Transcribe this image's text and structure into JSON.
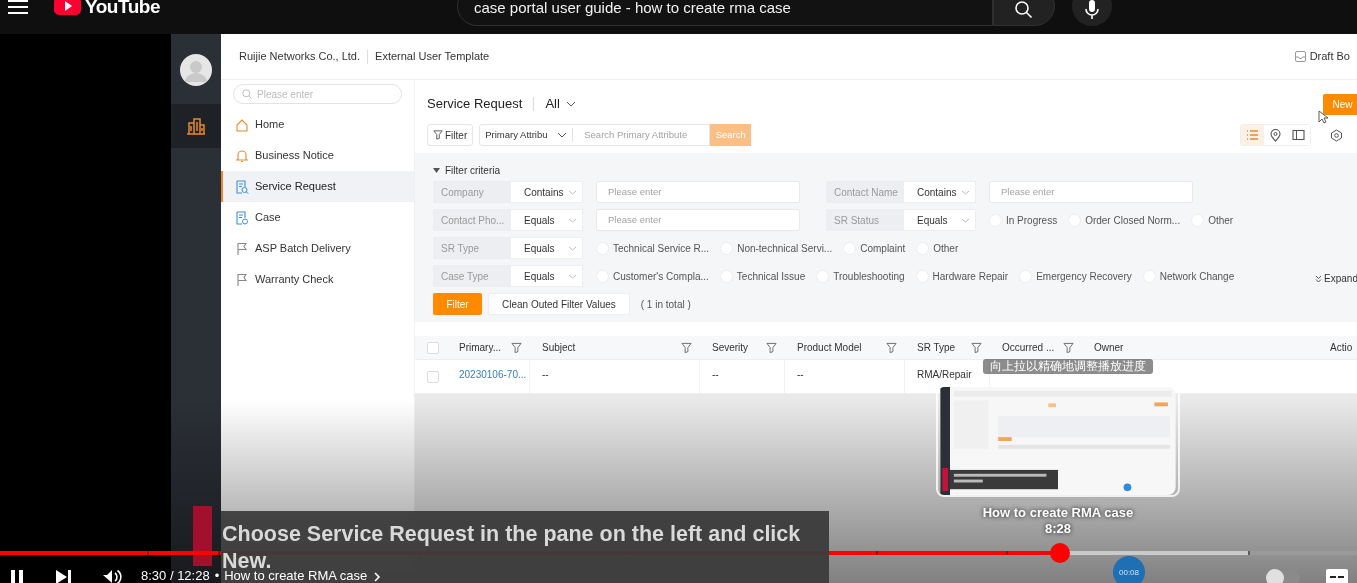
{
  "top_bar": {
    "logo": "YouTube",
    "search_query": "case portal user guide - how to create rma case"
  },
  "app": {
    "company": "Ruijie Networks Co., Ltd.",
    "template": "External User Template",
    "draft": "Draft Bo",
    "rail": [
      {
        "kind": "building",
        "selected": true
      }
    ],
    "sidebar": {
      "search_placeholder": "Please enter",
      "items": [
        {
          "label": "Home",
          "kind": "home",
          "selected": false
        },
        {
          "label": "Business Notice",
          "kind": "bell",
          "selected": false
        },
        {
          "label": "Service Request",
          "kind": "search-doc",
          "selected": true
        },
        {
          "label": "Case",
          "kind": "doc",
          "selected": false
        },
        {
          "label": "ASP Batch Delivery",
          "kind": "flag",
          "selected": false
        },
        {
          "label": "Warranty Check",
          "kind": "flag",
          "selected": false
        }
      ]
    },
    "page": {
      "title": "Service Request",
      "view": "All",
      "filter_button": "Filter",
      "attribute": "Primary Attribu",
      "search_placeholder": "Search Primary Attribute",
      "search_button": "Search",
      "new_button": "New",
      "view_modes": [
        {
          "kind": "list",
          "selected": true
        },
        {
          "kind": "map",
          "selected": false
        },
        {
          "kind": "panel",
          "selected": false
        }
      ]
    },
    "filter": {
      "title": "Filter criteria",
      "expanded": true,
      "rows": [
        [
          {
            "field": "Company",
            "operator": "Contains",
            "kind": "text",
            "placeholder": "Please enter"
          },
          {
            "field": "Contact Name",
            "operator": "Contains",
            "kind": "text",
            "placeholder": "Please enter"
          }
        ],
        [
          {
            "field": "Contact Pho...",
            "operator": "Equals",
            "kind": "text",
            "placeholder": "Please enter"
          },
          {
            "field": "SR Status",
            "operator": "Equals",
            "kind": "options",
            "options": [
              {
                "label": "In Progress",
                "checked": false
              },
              {
                "label": "Order Closed Norm...",
                "checked": false
              },
              {
                "label": "Other",
                "checked": false
              }
            ]
          }
        ],
        [
          {
            "field": "SR Type",
            "operator": "Equals",
            "kind": "options",
            "options": [
              {
                "label": "Technical Service R...",
                "checked": false
              },
              {
                "label": "Non-technical Servi...",
                "checked": false
              },
              {
                "label": "Complaint",
                "checked": false
              },
              {
                "label": "Other",
                "checked": false
              }
            ]
          }
        ],
        [
          {
            "field": "Case Type",
            "operator": "Equals",
            "kind": "options",
            "options": [
              {
                "label": "Customer's Compla...",
                "checked": false
              },
              {
                "label": "Technical Issue",
                "checked": false
              },
              {
                "label": "Troubleshooting",
                "checked": false
              },
              {
                "label": "Hardware Repair",
                "checked": false
              },
              {
                "label": "Emergency Recovery",
                "checked": false
              },
              {
                "label": "Network Change",
                "checked": false
              }
            ]
          }
        ]
      ],
      "expand": "Expand",
      "apply": "Filter",
      "clear": "Clean Outed Filter Values",
      "total": "( 1 in total )"
    },
    "table": {
      "select_all": false,
      "columns": [
        {
          "label": "Primary...",
          "filter": true
        },
        {
          "label": "Subject",
          "filter": true
        },
        {
          "label": "Severity",
          "filter": true
        },
        {
          "label": "Product Model",
          "filter": true
        },
        {
          "label": "SR Type",
          "filter": true
        },
        {
          "label": "Occurred ...",
          "filter": true
        },
        {
          "label": "Owner",
          "filter": false
        },
        {
          "label": "Actio",
          "filter": false
        }
      ],
      "rows": [
        {
          "checked": false,
          "cells": [
            "20230106-70...",
            "--",
            "--",
            "--",
            "RMA/Repair"
          ]
        }
      ]
    }
  },
  "player": {
    "seek_hint": "向上拉以精确地调整播放进度",
    "preview": {
      "title": "How to create RMA case",
      "time": "8:28"
    },
    "caption": "Choose Service Request in the pane on the left and click New.",
    "progress": {
      "level": 0.781
    },
    "autoplay": {
      "on": false
    },
    "time": "8:30 / 12:28",
    "separator": "•",
    "chapter": "How to create RMA case",
    "bubble": "00:08"
  }
}
